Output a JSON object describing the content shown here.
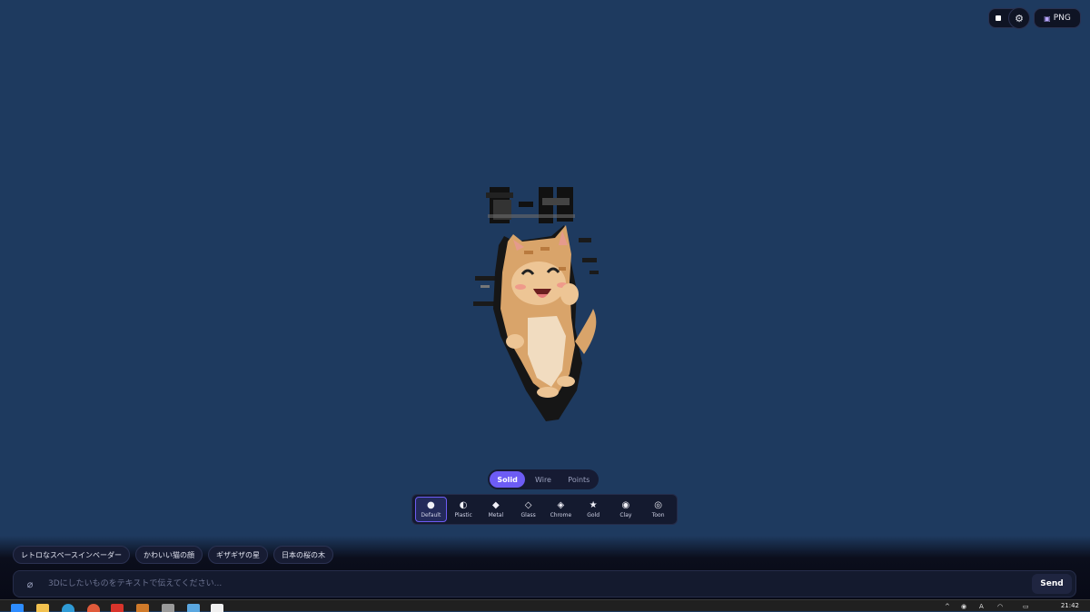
{
  "top_controls": {
    "png_label": "PNG"
  },
  "modes": [
    {
      "label": "Solid",
      "active": true
    },
    {
      "label": "Wire",
      "active": false
    },
    {
      "label": "Points",
      "active": false
    }
  ],
  "materials": [
    {
      "icon": "●",
      "label": "Default",
      "active": true
    },
    {
      "icon": "◐",
      "label": "Plastic",
      "active": false
    },
    {
      "icon": "◆",
      "label": "Metal",
      "active": false
    },
    {
      "icon": "◇",
      "label": "Glass",
      "active": false
    },
    {
      "icon": "◈",
      "label": "Chrome",
      "active": false
    },
    {
      "icon": "★",
      "label": "Gold",
      "active": false
    },
    {
      "icon": "◉",
      "label": "Clay",
      "active": false
    },
    {
      "icon": "◎",
      "label": "Toon",
      "active": false
    }
  ],
  "suggestions": [
    "レトロなスペースインベーダー",
    "かわいい猫の顔",
    "ギザギザの星",
    "日本の桜の木"
  ],
  "input": {
    "placeholder": "3Dにしたいものをテキストで伝えてください...",
    "send_label": "Send"
  },
  "taskbar": {
    "clock": "21:42"
  }
}
